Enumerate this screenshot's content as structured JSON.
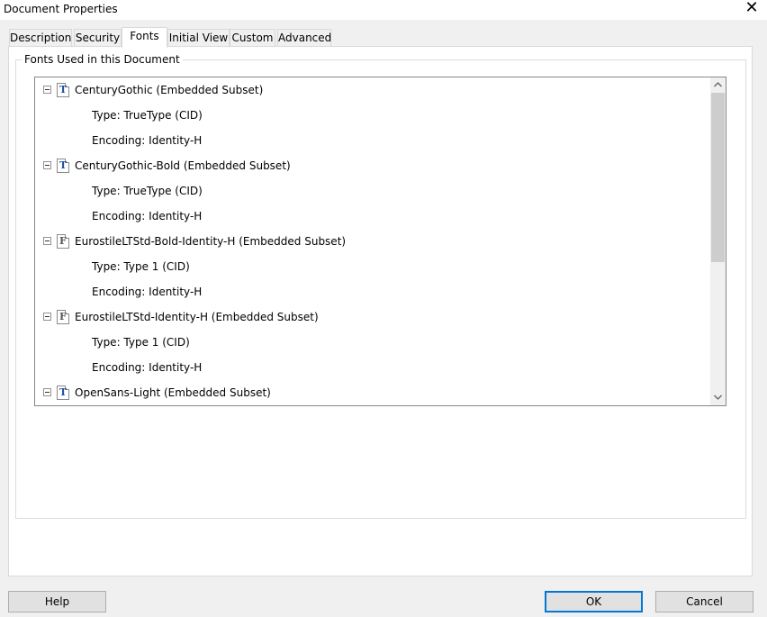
{
  "window": {
    "title": "Document Properties",
    "close_glyph": "✕"
  },
  "tabs": [
    {
      "label": "Description"
    },
    {
      "label": "Security"
    },
    {
      "label": "Fonts",
      "active": true
    },
    {
      "label": "Initial View"
    },
    {
      "label": "Custom"
    },
    {
      "label": "Advanced"
    }
  ],
  "fonts_group": {
    "legend": "Fonts Used in this Document",
    "fonts": [
      {
        "name": "CenturyGothic (Embedded Subset)",
        "icon": "truetype-font-icon",
        "type": "Type: TrueType (CID)",
        "encoding": "Encoding: Identity-H"
      },
      {
        "name": "CenturyGothic-Bold (Embedded Subset)",
        "icon": "truetype-font-icon",
        "type": "Type: TrueType (CID)",
        "encoding": "Encoding: Identity-H"
      },
      {
        "name": "EurostileLTStd-Bold-Identity-H (Embedded Subset)",
        "icon": "type1-font-icon",
        "type": "Type: Type 1 (CID)",
        "encoding": "Encoding: Identity-H"
      },
      {
        "name": "EurostileLTStd-Identity-H (Embedded Subset)",
        "icon": "type1-font-icon",
        "type": "Type: Type 1 (CID)",
        "encoding": "Encoding: Identity-H"
      },
      {
        "name": "OpenSans-Light (Embedded Subset)",
        "icon": "truetype-font-icon"
      }
    ]
  },
  "buttons": {
    "help": "Help",
    "ok": "OK",
    "cancel": "Cancel"
  },
  "colors": {
    "default_button_border": "#0078d7",
    "truetype_glyph": "#1f4fa8"
  }
}
